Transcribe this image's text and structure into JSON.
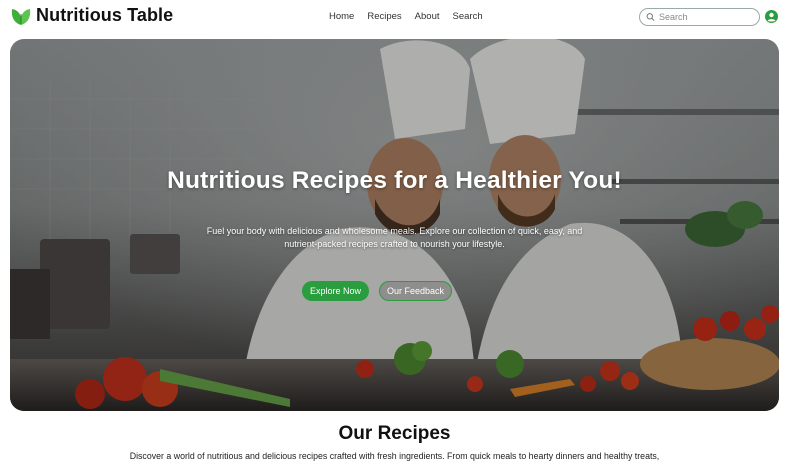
{
  "header": {
    "brand_name": "Nutritious Table",
    "logo_icon": "leaf-icon",
    "nav": [
      {
        "label": "Home"
      },
      {
        "label": "Recipes"
      },
      {
        "label": "About"
      },
      {
        "label": "Search"
      }
    ],
    "search": {
      "placeholder": "Search",
      "value": ""
    },
    "user_icon": "user-circle-icon"
  },
  "hero": {
    "title": "Nutritious Recipes for a Healthier You!",
    "subtitle": "Fuel your body with delicious and wholesome meals. Explore our collection of quick, easy, and nutrient-packed recipes crafted to nourish your lifestyle.",
    "primary_button": "Explore Now",
    "secondary_button": "Our Feedback",
    "image_alt": "Two chefs preparing vegetables in a professional kitchen"
  },
  "recipes_section": {
    "title": "Our Recipes",
    "description": "Discover a world of nutritious and delicious recipes crafted with fresh ingredients. From quick meals to hearty dinners and healthy treats,"
  },
  "colors": {
    "accent": "#2a9d3e",
    "brand_leaf": "#3fae3a",
    "text": "#111111"
  }
}
